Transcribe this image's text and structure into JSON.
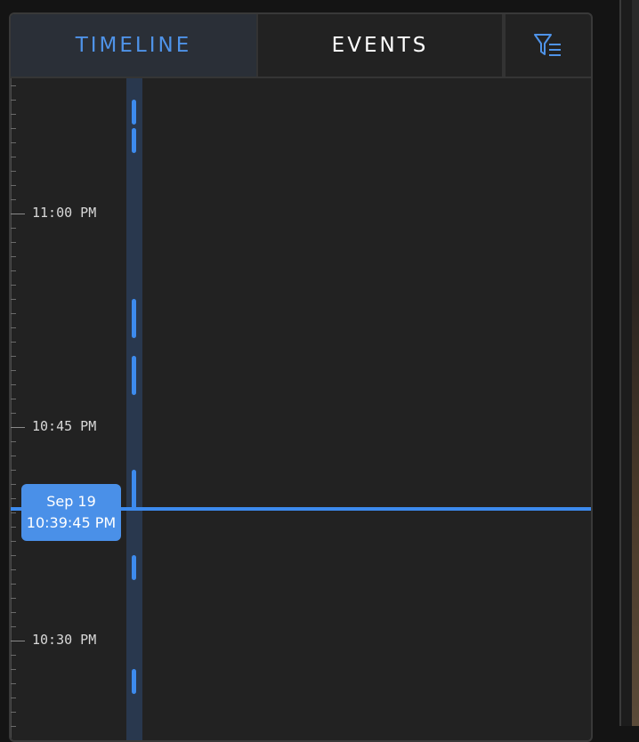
{
  "tabs": [
    {
      "label": "TIMELINE",
      "active": true
    },
    {
      "label": "EVENTS",
      "active": false
    }
  ],
  "filter_button": {
    "icon": "filter-list-icon"
  },
  "timeline": {
    "labels": [
      "11:00 PM",
      "10:45 PM",
      "10:30 PM"
    ],
    "cursor": {
      "date": "Sep 19",
      "time": "10:39:45 PM"
    }
  },
  "colors": {
    "accent": "#3d8bee",
    "panel_bg": "#222222",
    "active_tab_bg": "#2a2f37",
    "track_bg": "#29384e"
  }
}
